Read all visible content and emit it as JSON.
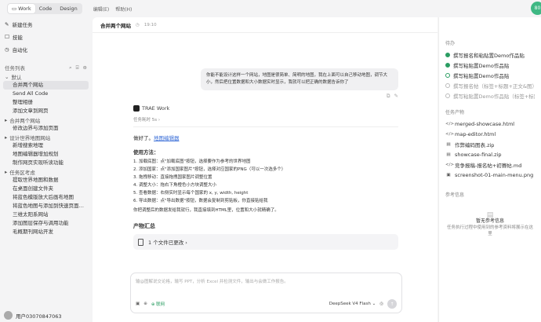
{
  "topbar": {
    "modes": [
      "Work",
      "Code",
      "Design"
    ],
    "active_mode": "Work",
    "nav": [
      "编辑(E)",
      "帮助(H)"
    ],
    "avatar": "80"
  },
  "sidebar": {
    "actions": [
      {
        "icon": "pencil-icon",
        "label": "新建任务"
      },
      {
        "icon": "skill-icon",
        "label": "技能"
      },
      {
        "icon": "automation-icon",
        "label": "自动化"
      }
    ],
    "section_title": "任务列表",
    "groups": [
      {
        "label": "默认",
        "items": [
          "合并两个网站",
          "Send All Code",
          "整理相册",
          "添加文章到网页"
        ]
      },
      {
        "label": "合并两个网站",
        "items": [
          "修改边界与添加页面"
        ]
      },
      {
        "label": "设计世界地图网站",
        "items": [
          "新增搜索地理",
          "地图编辑器增加规划",
          "制作网页实现听读功能"
        ]
      },
      {
        "label": "任务区考虑",
        "items": [
          "提取世界地图和数据",
          "在桌面创建文件夹",
          "将蓝色模版放大后画布地图",
          "将蓝色地图与添加到快速页面设计答案PPT",
          "三维太阳系网站",
          "添加图层保存与调用功能",
          "毛概期刊网站开发"
        ]
      }
    ],
    "selected_item": "合并两个网站",
    "user": "用户03070847063"
  },
  "main": {
    "title": "合并两个网站",
    "time": "19:10",
    "user_message": "你能不能设计这样一个网站，地图是很简单、简明的地图，我在上面可以自己移动地图，调节大小，然后把位置数据和大小数据实时显示，我就可以把正确的数据告诉你了",
    "agent_name": "TRAE Work",
    "collapsed_steps": "任务耗时 5s ›",
    "reply_prefix": "做好了。",
    "reply_link": "地图编辑器",
    "usage_title": "使用方法：",
    "steps": [
      "1. 加载底图：点\"加载底图\"按钮，选择要作为参考的世界地图",
      "2. 添加国家：点\"添加国家图片\"按钮，选择对应国家的PNG（可以一次选多个）",
      "3. 拖拽移动：直接拖拽国家图片调整位置",
      "4. 调整大小：拖右下角橙色小方块调整大小",
      "5. 查看数据：右侧实时显示每个国家的 x, y, width, height",
      "6. 导出数据：点\"导出数据\"按钮，数据会复制到剪贴板，你直接贴给我"
    ],
    "closing": "你把调整后的数据发给我就行，我直接填到HTML里，位置和大小就精确了。",
    "outputs_title": "产物汇总",
    "outputs_card": "1 个文件已更改 ›",
    "input_placeholder": "输@图解说交论格，输写 PPT，分析 Excel 并检测文件，输出与会做工作报告。",
    "net_label": "联网",
    "model": "DeepSeek V4 Flash ⌄"
  },
  "right": {
    "tasks_title": "待办",
    "tasks": [
      {
        "label": "撰写报名和粘贴置Demo作品贴",
        "state": "done"
      },
      {
        "label": "撰写粘贴置Demo作品贴",
        "state": "done"
      },
      {
        "label": "撰写粘贴置Demo作品贴",
        "state": "active"
      },
      {
        "label": "撰写报名帖（标签+标题+正文&图）",
        "state": "muted"
      },
      {
        "label": "撰写粘贴置Demo作品贴（标签+标题+",
        "state": "muted"
      }
    ],
    "products_title": "任务产物",
    "products": [
      {
        "icon": "</>",
        "label": "merged-showcase.html"
      },
      {
        "icon": "</>",
        "label": "map-editor.html"
      },
      {
        "icon": "▤",
        "label": "作弊编码图表.zip"
      },
      {
        "icon": "▤",
        "label": "showcase-final.zip"
      },
      {
        "icon": "</>",
        "label": "竞争报稿-报名帖+初赛帖.md"
      },
      {
        "icon": "▣",
        "label": "screenshot-01-main-menu.png"
      }
    ],
    "ref_title": "参考信息",
    "ref_empty_title": "暂无参考信息",
    "ref_empty_desc": "任务执行过程中使用到的参考资料将展示在这里"
  }
}
